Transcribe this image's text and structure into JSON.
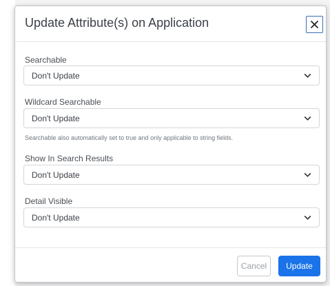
{
  "dialog": {
    "title": "Update Attribute(s) on Application",
    "close_label": "Close"
  },
  "fields": [
    {
      "label": "Searchable",
      "value": "Don't Update"
    },
    {
      "label": "Wildcard Searchable",
      "value": "Don't Update",
      "help": "Searchable also automatically set to true and only applicable to string fields."
    },
    {
      "label": "Show In Search Results",
      "value": "Don't Update"
    },
    {
      "label": "Detail Visible",
      "value": "Don't Update"
    }
  ],
  "footer": {
    "cancel_label": "Cancel",
    "update_label": "Update"
  },
  "colors": {
    "primary": "#1a73e8",
    "close_border": "#3b6fb6"
  },
  "icons": {
    "close": "close-icon",
    "chevron": "chevron-down-icon"
  }
}
